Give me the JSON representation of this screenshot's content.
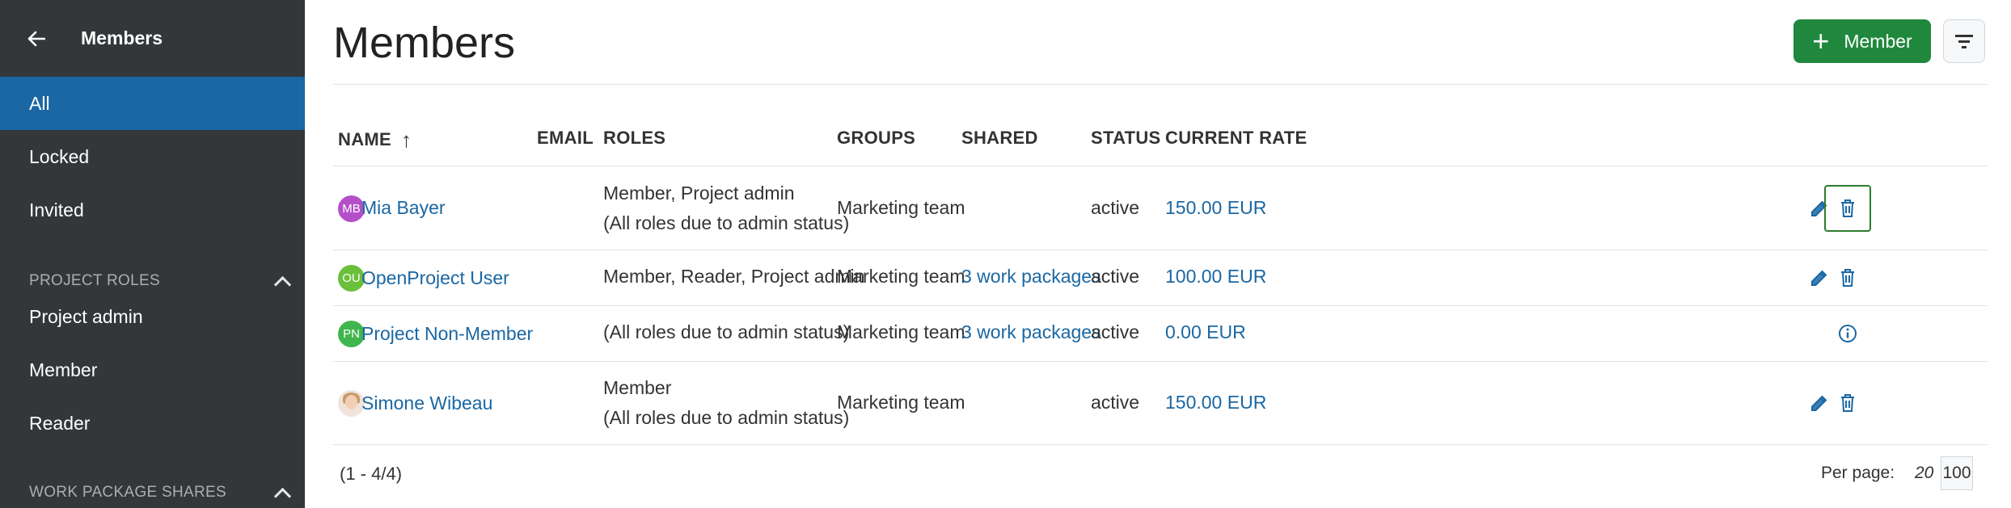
{
  "sidebar": {
    "back_icon": "arrow-left-icon",
    "title": "Members",
    "items": [
      {
        "label": "All",
        "active": true
      },
      {
        "label": "Locked"
      },
      {
        "label": "Invited"
      }
    ],
    "sections": [
      {
        "label": "PROJECT ROLES",
        "items": [
          "Project admin",
          "Member",
          "Reader"
        ]
      },
      {
        "label": "WORK PACKAGE SHARES"
      }
    ],
    "colors": {
      "background": "#333739",
      "active": "#1a67a3"
    }
  },
  "header": {
    "title": "Members",
    "add_button_label": "Member",
    "add_button_icon": "plus-icon",
    "filter_icon": "filter-icon",
    "accent": "#1f883d"
  },
  "table": {
    "columns": [
      "NAME",
      "EMAIL",
      "ROLES",
      "GROUPS",
      "SHARED",
      "STATUS",
      "CURRENT RATE"
    ],
    "sort_icon": "sort-ascending-arrow-icon",
    "rows": [
      {
        "initials": "MB",
        "avatar_color": "#b44fc9",
        "name": "Mia Bayer",
        "roles_line1": "Member, Project admin",
        "roles_line2": "(All roles due to admin status)",
        "group": "Marketing team",
        "shared": "",
        "status": "active",
        "rate": "150.00 EUR",
        "actions": [
          "edit-icon",
          "delete-icon"
        ]
      },
      {
        "initials": "OU",
        "avatar_color": "#6cbf3a",
        "name": "OpenProject User",
        "roles_line1": "Member, Reader, Project admin",
        "group": "Marketing team",
        "shared": "3 work packages",
        "status": "active",
        "rate": "100.00 EUR",
        "actions": [
          "edit-icon",
          "delete-icon"
        ]
      },
      {
        "initials": "PN",
        "avatar_color": "#3fb54e",
        "name": "Project Non-Member",
        "roles_line1": "(All roles due to admin status)",
        "group": "Marketing team",
        "shared": "3 work packages",
        "status": "active",
        "rate": "0.00 EUR",
        "actions": [
          "info-icon"
        ]
      },
      {
        "initials": "",
        "avatar_color": "photo",
        "name": "Simone Wibeau",
        "roles_line1": "Member",
        "roles_line2": "(All roles due to admin status)",
        "group": "Marketing team",
        "shared": "",
        "status": "active",
        "rate": "150.00 EUR",
        "actions": [
          "edit-icon",
          "delete-icon"
        ]
      }
    ]
  },
  "footer": {
    "count": "(1 - 4/4)",
    "per_page_label": "Per page:",
    "per_page_options": [
      "20",
      "100"
    ],
    "per_page_selected": "100"
  }
}
